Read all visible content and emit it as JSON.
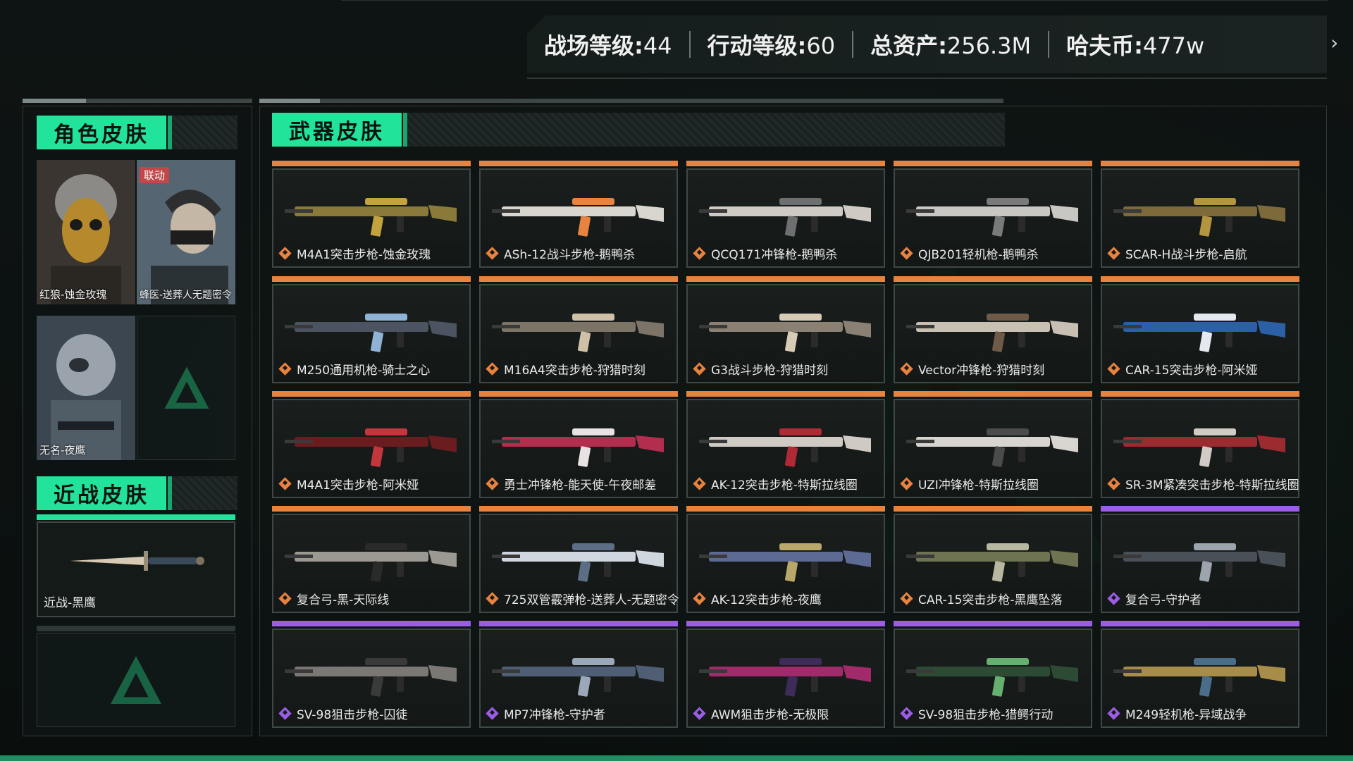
{
  "stats": {
    "battlefield_label": "战场等级:",
    "battlefield_value": "44",
    "operation_label": "行动等级:",
    "operation_value": "60",
    "assets_label": "总资产:",
    "assets_value": "256.3M",
    "coins_label": "哈夫币:",
    "coins_value": "477w",
    "next_arrow": "›"
  },
  "sections": {
    "character": "角色皮肤",
    "weapon": "武器皮肤",
    "melee": "近战皮肤"
  },
  "characters": [
    {
      "name": "红狼-蚀金玫瑰",
      "tag": ""
    },
    {
      "name": "蜂医-送葬人无题密令",
      "tag": "联动"
    },
    {
      "name": "无名-夜鹰",
      "tag": ""
    }
  ],
  "melee": {
    "name": "近战-黑鹰"
  },
  "weapons": [
    {
      "name": "M4A1突击步枪-蚀金玫瑰",
      "rarity": "orange"
    },
    {
      "name": "ASh-12战斗步枪-鹅鸭杀",
      "rarity": "orange"
    },
    {
      "name": "QCQ171冲锋枪-鹅鸭杀",
      "rarity": "orange"
    },
    {
      "name": "QJB201轻机枪-鹅鸭杀",
      "rarity": "orange"
    },
    {
      "name": "SCAR-H战斗步枪-启航",
      "rarity": "orange"
    },
    {
      "name": "M250通用机枪-骑士之心",
      "rarity": "orange"
    },
    {
      "name": "M16A4突击步枪-狩猎时刻",
      "rarity": "orange"
    },
    {
      "name": "G3战斗步枪-狩猎时刻",
      "rarity": "orange"
    },
    {
      "name": "Vector冲锋枪-狩猎时刻",
      "rarity": "orange"
    },
    {
      "name": "CAR-15突击步枪-阿米娅",
      "rarity": "orange"
    },
    {
      "name": "M4A1突击步枪-阿米娅",
      "rarity": "orange"
    },
    {
      "name": "勇士冲锋枪-能天使-午夜邮差",
      "rarity": "orange"
    },
    {
      "name": "AK-12突击步枪-特斯拉线圈",
      "rarity": "orange"
    },
    {
      "name": "UZI冲锋枪-特斯拉线圈",
      "rarity": "orange"
    },
    {
      "name": "SR-3M紧凑突击步枪-特斯拉线圈",
      "rarity": "orange"
    },
    {
      "name": "复合弓-黑-天际线",
      "rarity": "orange"
    },
    {
      "name": "725双管霰弹枪-送葬人-无题密令",
      "rarity": "orange"
    },
    {
      "name": "AK-12突击步枪-夜鹰",
      "rarity": "orange"
    },
    {
      "name": "CAR-15突击步枪-黑鹰坠落",
      "rarity": "orange"
    },
    {
      "name": "复合弓-守护者",
      "rarity": "purple"
    },
    {
      "name": "SV-98狙击步枪-囚徒",
      "rarity": "purple"
    },
    {
      "name": "MP7冲锋枪-守护者",
      "rarity": "purple"
    },
    {
      "name": "AWM狙击步枪-无极限",
      "rarity": "purple"
    },
    {
      "name": "SV-98狙击步枪-猎鳄行动",
      "rarity": "purple"
    },
    {
      "name": "M249轻机枪-异域战争",
      "rarity": "purple"
    }
  ],
  "colors": {
    "accent": "#22e39a",
    "orange": "#e8823f",
    "purple": "#9b5de5",
    "collab": "#c2474a"
  }
}
